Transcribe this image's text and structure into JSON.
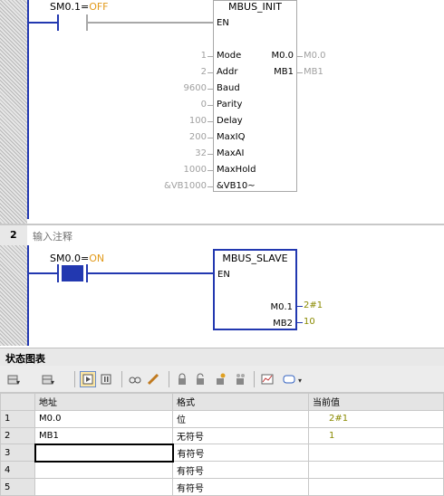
{
  "network1": {
    "contact": {
      "address": "SM0.1",
      "sep": "=",
      "state": "OFF"
    },
    "block": {
      "title": "MBUS_INIT",
      "en_label": "EN",
      "inputs": [
        {
          "value": "1",
          "pin": "Mode"
        },
        {
          "value": "2",
          "pin": "Addr"
        },
        {
          "value": "9600",
          "pin": "Baud"
        },
        {
          "value": "0",
          "pin": "Parity"
        },
        {
          "value": "100",
          "pin": "Delay"
        },
        {
          "value": "200",
          "pin": "MaxIQ"
        },
        {
          "value": "32",
          "pin": "MaxAI"
        },
        {
          "value": "1000",
          "pin": "MaxHold"
        },
        {
          "value": "&VB1000",
          "pin": "&VB10~"
        }
      ],
      "outputs": [
        {
          "pin": "M0.0",
          "value": "M0.0"
        },
        {
          "pin": "MB1",
          "value": "MB1"
        }
      ]
    }
  },
  "network2": {
    "number": "2",
    "comment": "输入注释",
    "contact": {
      "address": "SM0.0",
      "sep": "=",
      "state": "ON"
    },
    "block": {
      "title": "MBUS_SLAVE",
      "en_label": "EN",
      "outputs": [
        {
          "pin": "M0.1",
          "value": "2#1"
        },
        {
          "pin": "MB2",
          "value": "10"
        }
      ]
    }
  },
  "status_chart": {
    "title": "状态图表",
    "headers": {
      "address": "地址",
      "format": "格式",
      "current": "当前值"
    },
    "rows": [
      {
        "no": "1",
        "address": "M0.0",
        "format": "位",
        "value": "2#1"
      },
      {
        "no": "2",
        "address": "MB1",
        "format": "无符号",
        "value": "1"
      },
      {
        "no": "3",
        "address": "",
        "format": "有符号",
        "value": ""
      },
      {
        "no": "4",
        "address": "",
        "format": "有符号",
        "value": ""
      },
      {
        "no": "5",
        "address": "",
        "format": "有符号",
        "value": ""
      }
    ],
    "toolbar_icons": [
      "add-row-icon",
      "delete-row-icon",
      "trend-view-icon",
      "pause-icon",
      "glasses-icon",
      "pencil-icon",
      "lock-icon",
      "unlock-icon",
      "force-icon",
      "unforce-all-icon",
      "chart-icon",
      "comment-icon"
    ]
  },
  "colors": {
    "rail": "#2238b0",
    "inactive": "#a8a8a8",
    "state": "#e29a1a",
    "live_value": "#8a8a00"
  }
}
